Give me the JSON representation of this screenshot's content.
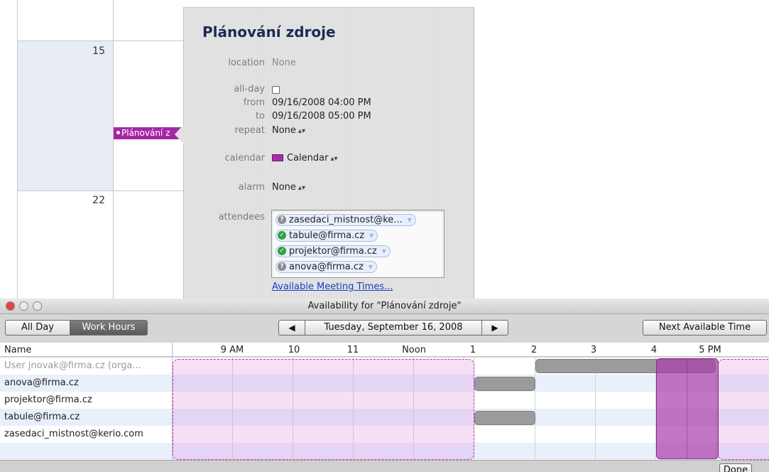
{
  "calendar": {
    "week_day_numbers": [
      "15",
      "22"
    ],
    "event_chip_label": "Plánování z"
  },
  "popover": {
    "title": "Plánování zdroje",
    "location_label": "location",
    "location_value": "None",
    "allday_label": "all-day",
    "allday_checked": false,
    "from_label": "from",
    "from_value": "09/16/2008 04:00 PM",
    "to_label": "to",
    "to_value": "09/16/2008 05:00 PM",
    "repeat_label": "repeat",
    "repeat_value": "None",
    "calendar_label": "calendar",
    "calendar_value": "Calendar",
    "calendar_color": "#a62ea6",
    "alarm_label": "alarm",
    "alarm_value": "None",
    "attendees_label": "attendees",
    "attendees": [
      {
        "email": "zasedaci_mistnost@ke...",
        "status": "unknown"
      },
      {
        "email": "tabule@firma.cz",
        "status": "accepted"
      },
      {
        "email": "projektor@firma.cz",
        "status": "accepted"
      },
      {
        "email": "anova@firma.cz",
        "status": "unknown"
      }
    ],
    "available_times_link": "Available Meeting Times..."
  },
  "availability": {
    "window_title": "Availability for \"Plánování zdroje\"",
    "view_modes": [
      "All Day",
      "Work Hours"
    ],
    "active_view_mode": "Work Hours",
    "date": "Tuesday, September 16, 2008",
    "prev_icon": "left-triangle-icon",
    "next_icon": "right-triangle-icon",
    "next_available_button": "Next Available Time",
    "name_column_header": "Name",
    "hours": [
      "9 AM",
      "10",
      "11",
      "Noon",
      "1",
      "2",
      "3",
      "4",
      "5 PM"
    ],
    "people": [
      "User jnovak@firma.cz (orga...",
      "anova@firma.cz",
      "projektor@firma.cz",
      "tabule@firma.cz",
      "zasedaci_mistnost@kerio.com"
    ],
    "busy_times": [
      {
        "person": "User jnovak@firma.cz (orga...",
        "start": "2",
        "end": "5 PM"
      },
      {
        "person": "anova@firma.cz",
        "start": "1",
        "end": "2"
      },
      {
        "person": "tabule@firma.cz",
        "start": "1",
        "end": "2"
      }
    ],
    "proposed_meeting": {
      "start": "4",
      "end": "5 PM"
    },
    "done_button": "Done",
    "highlight_color": "#aa3caa"
  }
}
